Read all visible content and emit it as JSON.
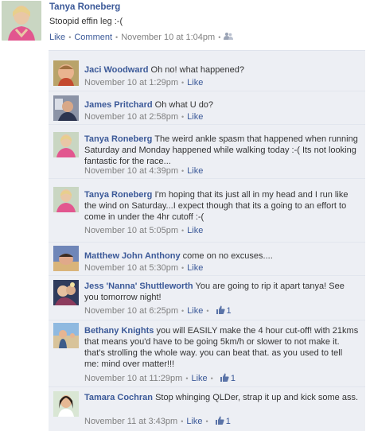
{
  "post": {
    "author": "Tanya Roneberg",
    "text": "Stoopid effin leg :-(",
    "like_label": "Like",
    "comment_label": "Comment",
    "timestamp": "November 10 at 1:04pm"
  },
  "comments": [
    {
      "author": "Jaci Woodward",
      "text": "Oh no! what happened?",
      "timestamp": "November 10 at 1:29pm",
      "like_label": "Like",
      "likes": ""
    },
    {
      "author": "James Pritchard",
      "text": "Oh what U do?",
      "timestamp": "November 10 at 2:58pm",
      "like_label": "Like",
      "likes": ""
    },
    {
      "author": "Tanya Roneberg",
      "text": "The weird ankle spasm that happened when running Saturday and Monday happened while walking today :-( Its not looking fantastic for the race...",
      "timestamp": "November 10 at 4:39pm",
      "like_label": "Like",
      "likes": ""
    },
    {
      "author": "Tanya Roneberg",
      "text": "I'm hoping that its just all in my head and I run like the wind on Saturday...I expect though that its a going to an effort to come in under the 4hr cutoff :-(",
      "timestamp": "November 10 at 5:05pm",
      "like_label": "Like",
      "likes": ""
    },
    {
      "author": "Matthew John Anthony",
      "text": "come on no excuses....",
      "timestamp": "November 10 at 5:30pm",
      "like_label": "Like",
      "likes": ""
    },
    {
      "author": "Jess 'Nanna' Shuttleworth",
      "text": "You are going to rip it apart tanya! See you tomorrow night!",
      "timestamp": "November 10 at 6:25pm",
      "like_label": "Like",
      "likes": "1"
    },
    {
      "author": "Bethany Knights",
      "text": "you will EASILY make the 4 hour cut-off! with 21kms that means you'd have to be going 5km/h or slower to not make it. that's strolling the whole way. you can beat that. as you used to tell me: mind over matter!!!",
      "timestamp": "November 10 at 11:29pm",
      "like_label": "Like",
      "likes": "1"
    },
    {
      "author": "Tamara Cochran",
      "text": "Stop whinging QLDer, strap it up and kick some ass.",
      "timestamp": "November 11 at 3:43pm",
      "like_label": "Like",
      "likes": "1"
    }
  ],
  "icons": {
    "audience": "friends-icon",
    "like_count": "thumbs-up-icon"
  },
  "colors": {
    "link": "#3b5998",
    "comment_bg": "#edeff4",
    "meta": "#808080"
  }
}
